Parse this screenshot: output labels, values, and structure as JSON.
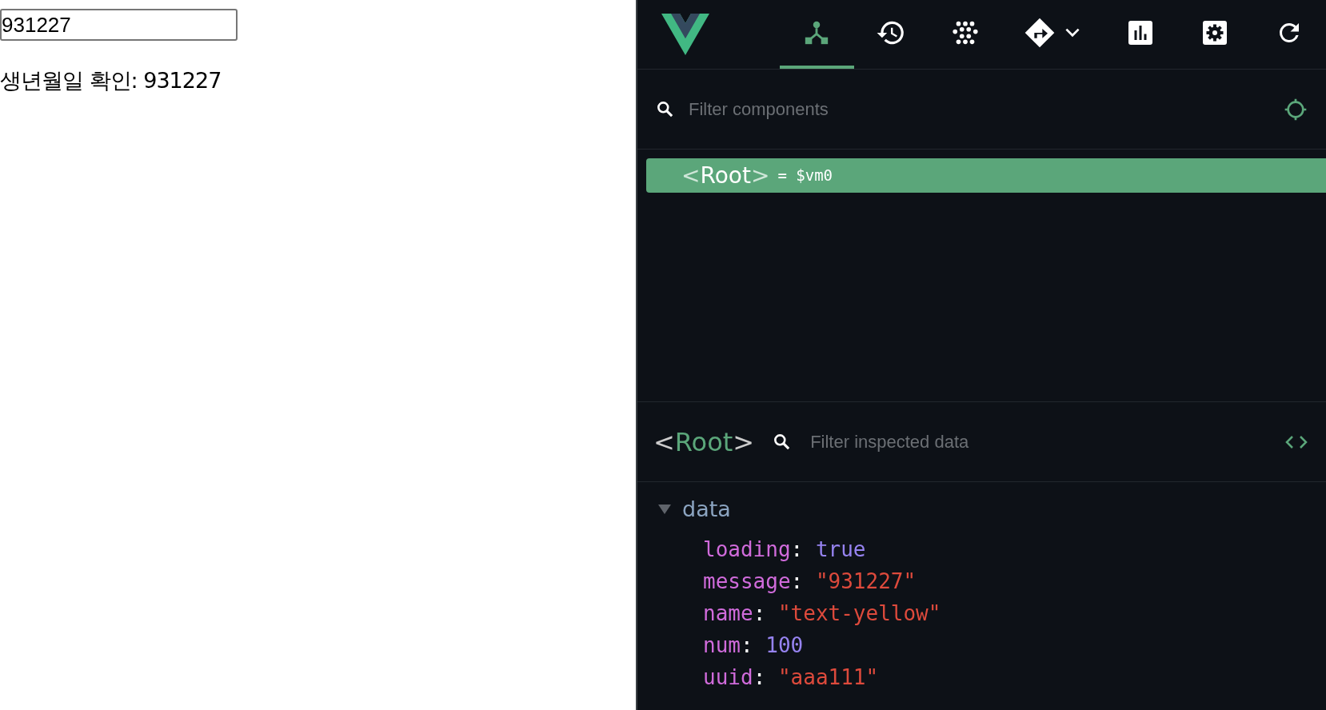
{
  "page": {
    "birth_input": {
      "value": "931227"
    },
    "confirm_text": "생년월일 확인: 931227"
  },
  "devtools": {
    "tabs": [
      {
        "kind": "components",
        "selected": true
      },
      {
        "kind": "timeline",
        "selected": false
      },
      {
        "kind": "graph",
        "selected": false
      },
      {
        "kind": "router",
        "selected": false
      },
      {
        "kind": "chart",
        "selected": false
      },
      {
        "kind": "settings",
        "selected": false
      },
      {
        "kind": "refresh",
        "selected": false
      }
    ],
    "component_filter": {
      "placeholder": "Filter components"
    },
    "tree": [
      {
        "open": "<",
        "name": "Root",
        "close": ">",
        "suffix": "= $vm0",
        "selected": true
      }
    ],
    "inspector": {
      "open": "<",
      "name": "Root",
      "close": ">",
      "filter_placeholder": "Filter inspected data",
      "sections": [
        {
          "title": "data",
          "expanded": true,
          "fields": [
            {
              "key": "loading",
              "sep": ":",
              "value": "true",
              "kind": "literal"
            },
            {
              "key": "message",
              "sep": ":",
              "value": "\"931227\"",
              "kind": "string"
            },
            {
              "key": "name",
              "sep": ":",
              "value": "\"text-yellow\"",
              "kind": "string"
            },
            {
              "key": "num",
              "sep": ":",
              "value": "100",
              "kind": "literal"
            },
            {
              "key": "uuid",
              "sep": ":",
              "value": "\"aaa111\"",
              "kind": "string"
            }
          ]
        }
      ]
    }
  }
}
